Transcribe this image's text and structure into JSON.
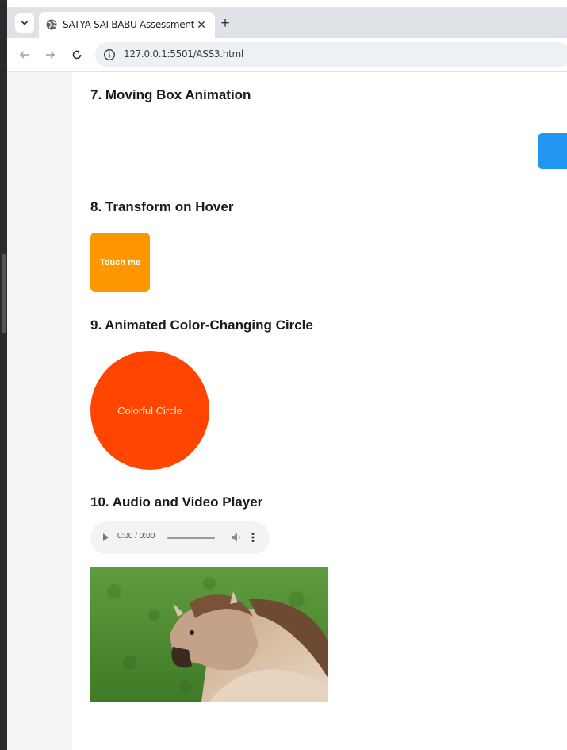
{
  "browser": {
    "tab_title": "SATYA SAI BABU Assessment",
    "url": "127.0.0.1:5501/ASS3.html"
  },
  "sections": {
    "moving_box": {
      "heading": "7. Moving Box Animation",
      "box_color": "#2196f3"
    },
    "transform": {
      "heading": "8. Transform on Hover",
      "box_label": "Touch me",
      "box_color": "#ff9800"
    },
    "circle": {
      "heading": "9. Animated Color-Changing Circle",
      "label": "Colorful Circle",
      "color": "#ff4500"
    },
    "media": {
      "heading": "10. Audio and Video Player",
      "audio_time": "0:00 / 0:00"
    }
  },
  "icons": [
    "tab-search-icon",
    "globe-icon",
    "close-icon",
    "plus-icon",
    "back-arrow-icon",
    "forward-arrow-icon",
    "reload-icon",
    "site-info-icon",
    "play-icon",
    "volume-icon",
    "more-options-icon"
  ]
}
